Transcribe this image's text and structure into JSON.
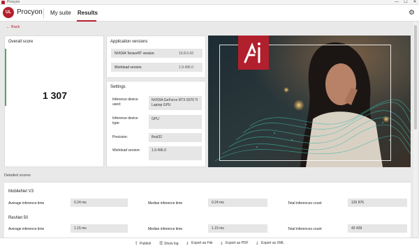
{
  "window": {
    "title": "Procyon",
    "controls": {
      "minimize": "—",
      "maximize": "☐",
      "close": "✕"
    }
  },
  "nav": {
    "logo": "UL",
    "brand": "Procyon",
    "tabs": [
      {
        "label": "My suite"
      },
      {
        "label": "Results"
      }
    ],
    "active_tab": "Results",
    "settings_icon": "gear-icon"
  },
  "back_label": "Back",
  "overall": {
    "title": "Overall score",
    "score": "1 307"
  },
  "app_versions": {
    "title": "Application versions",
    "rows": [
      {
        "label": "NVIDIA TensorRT version",
        "value": "10.8.0.43"
      },
      {
        "label": "Workload version",
        "value": "1.9.496.0"
      }
    ]
  },
  "settings": {
    "title": "Settings",
    "rows": [
      {
        "label": "Inference device used:",
        "value": "NVIDIA GeForce RTX 5070 Ti Laptop GPU"
      },
      {
        "label": "Inference device type:",
        "value": "GPU"
      },
      {
        "label": "Precision:",
        "value": "float32"
      },
      {
        "label": "Workload version:",
        "value": "1.9.496.0"
      }
    ]
  },
  "hero": {
    "badge": "AI"
  },
  "detailed": {
    "title": "Detailed scores",
    "models": [
      {
        "name": "MobileNet V3",
        "avg_label": "Average inference time",
        "avg_value": "0.24 ms",
        "median_label": "Median inference time",
        "median_value": "0.24 ms",
        "total_label": "Total inferences count",
        "total_value": "126 876"
      },
      {
        "name": "ResNet 50",
        "avg_label": "Average inference time",
        "avg_value": "1.15 ms",
        "median_label": "Median inference time",
        "median_value": "1.15 ms",
        "total_label": "Total inferences count",
        "total_value": "43 439"
      }
    ]
  },
  "actions": [
    {
      "label": "Publish",
      "icon": "publish-icon"
    },
    {
      "label": "Show log",
      "icon": "log-icon"
    },
    {
      "label": "Export as File",
      "icon": "export-file-icon"
    },
    {
      "label": "Export as PDF",
      "icon": "export-pdf-icon"
    },
    {
      "label": "Export as XML",
      "icon": "export-xml-icon"
    }
  ],
  "colors": {
    "brand_red": "#b21f2d",
    "score_accent": "#5ba55a"
  }
}
